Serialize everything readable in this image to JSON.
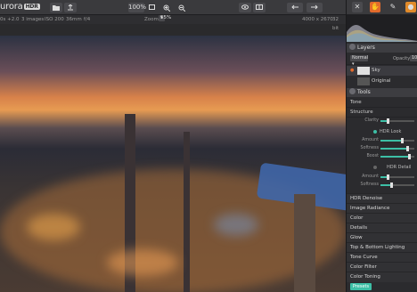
{
  "app": {
    "logo_text": "urora",
    "badge": "HDR"
  },
  "toolbar": {
    "zoom_pct": "100%",
    "undo_icon": "undo-arrow-icon",
    "redo_icon": "redo-arrow-icon"
  },
  "infobar": {
    "exposure": "0s +2.0",
    "images": "3 images",
    "iso": "ISO 200",
    "focal": "36mm",
    "aperture": "f/4",
    "zoom_label": "Zoom",
    "zoom_value": "55%",
    "dimensions": "4000 x 2670",
    "bits": "32 bit"
  },
  "layers": {
    "title": "Layers",
    "blend_mode": "Normal",
    "opacity_label": "Opacity",
    "opacity_value": "100",
    "items": [
      {
        "name": "Sky"
      },
      {
        "name": "Original"
      }
    ]
  },
  "tools": {
    "title": "Tools",
    "tone_label": "Tone",
    "structure_label": "Structure",
    "clarity_label": "Clarity",
    "hdr_look_label": "HDR Look",
    "hdr_look_sliders": [
      "Amount",
      "Softness",
      "Boost"
    ],
    "hdr_detail_label": "HDR Detail",
    "hdr_detail_sliders": [
      "Amount",
      "Softness"
    ],
    "sections": [
      "HDR Denoise",
      "Image Radiance",
      "Color",
      "Details",
      "Glow",
      "Top & Bottom Lighting",
      "Tone Curve",
      "Color Filter",
      "Color Toning"
    ],
    "presets_label": "Presets"
  },
  "colors": {
    "accent": "#3dbfa6",
    "panel": "#2b2b2e"
  }
}
